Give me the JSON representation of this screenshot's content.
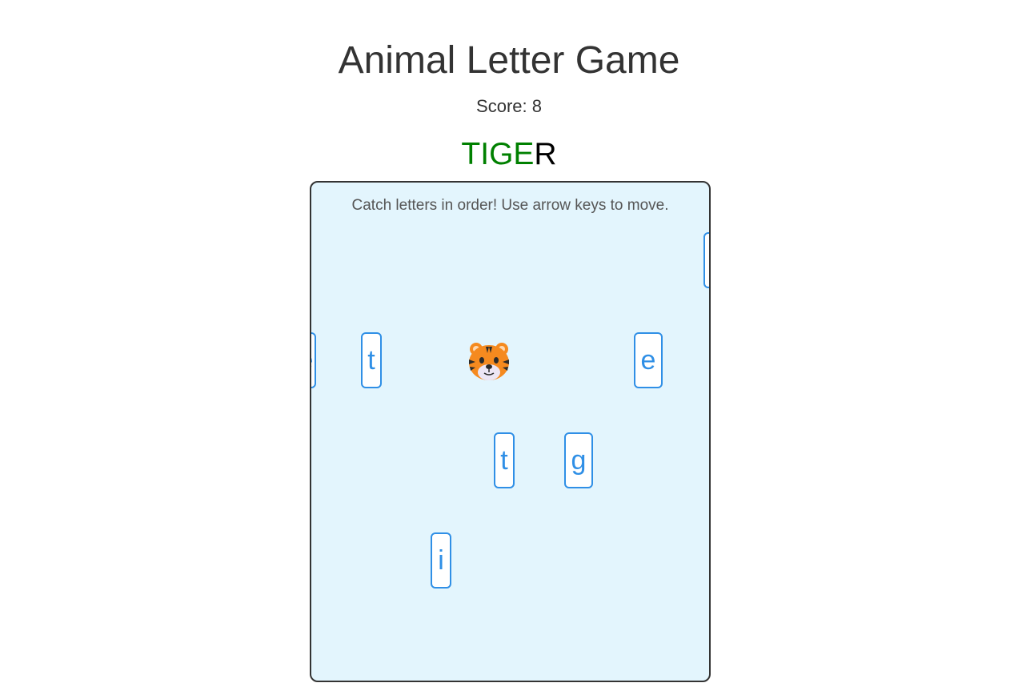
{
  "header": {
    "title": "Animal Letter Game",
    "score_text": "Score: 8"
  },
  "target_word": {
    "caught": "TIGE",
    "remaining": "R",
    "caught_color": "#008000",
    "remaining_color": "#000000"
  },
  "board": {
    "instructions": "Catch letters in order! Use arrow keys to move.",
    "background_color": "#e3f5fd",
    "tile_color": "#2f8fe6",
    "player": {
      "icon": "tiger-face-icon"
    },
    "tiles": [
      {
        "letter": "e"
      },
      {
        "letter": "t"
      },
      {
        "letter": "e"
      },
      {
        "letter": "t"
      },
      {
        "letter": "g"
      },
      {
        "letter": "i"
      },
      {
        "letter": ""
      }
    ]
  }
}
